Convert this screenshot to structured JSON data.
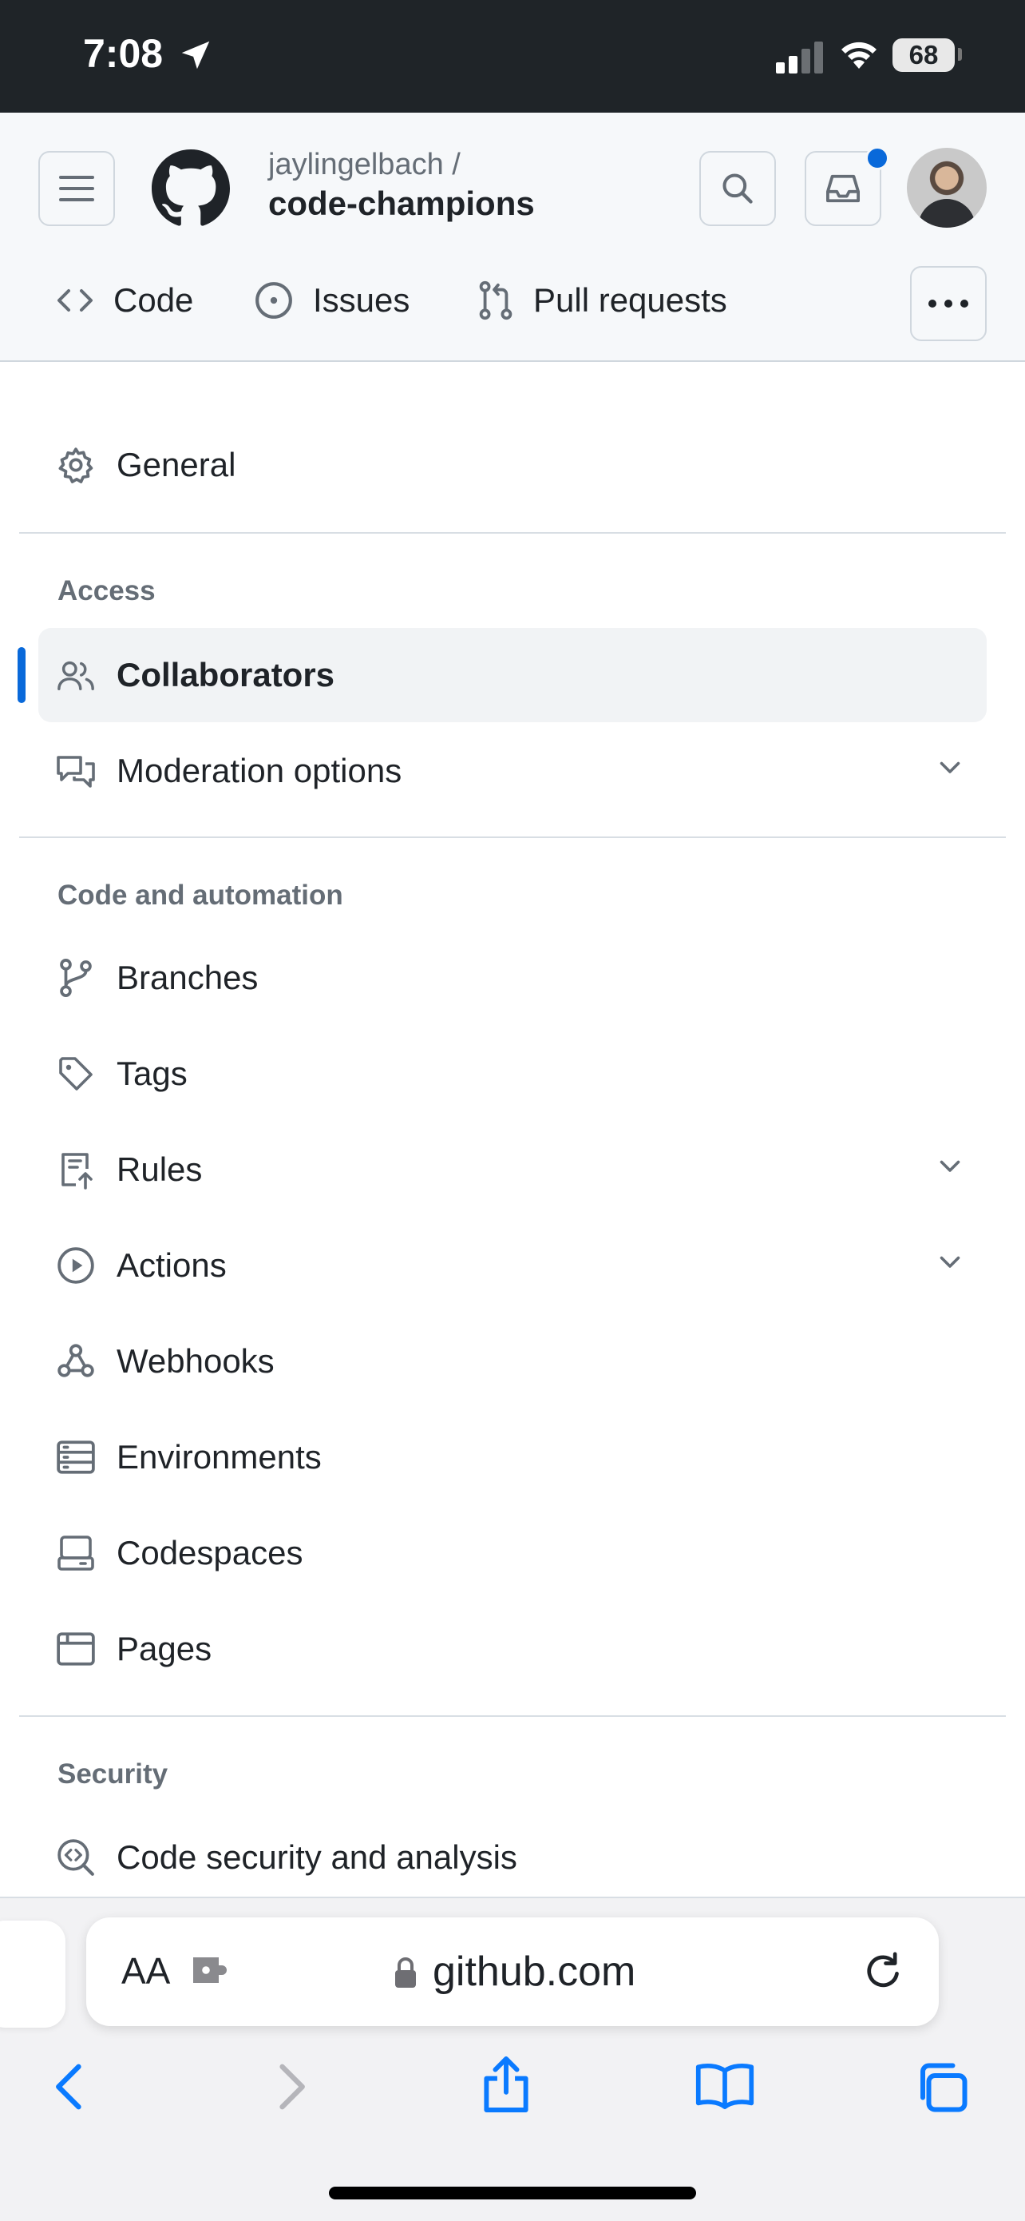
{
  "status_bar": {
    "time": "7:08",
    "battery": "68"
  },
  "header": {
    "owner": "jaylingelbach /",
    "repo": "code-champions",
    "tabs": [
      {
        "label": "Code",
        "icon": "code-icon"
      },
      {
        "label": "Issues",
        "icon": "issue-opened-icon"
      },
      {
        "label": "Pull requests",
        "icon": "git-pull-request-icon"
      }
    ]
  },
  "nav": {
    "general": "General",
    "sections": {
      "access": "Access",
      "code_automation": "Code and automation",
      "security": "Security"
    },
    "items": {
      "collaborators": "Collaborators",
      "moderation": "Moderation options",
      "branches": "Branches",
      "tags": "Tags",
      "rules": "Rules",
      "actions": "Actions",
      "webhooks": "Webhooks",
      "environments": "Environments",
      "codespaces": "Codespaces",
      "pages": "Pages",
      "code_security": "Code security and analysis"
    },
    "active_item": "Collaborators"
  },
  "safari": {
    "text_size_label": "AA",
    "url": "github.com"
  },
  "colors": {
    "accent": "#0969da",
    "status_bar_bg": "#1f2428",
    "header_bg": "#f6f8fa",
    "text_primary": "#1f2328",
    "text_muted": "#656d76",
    "safari_blue": "#0a7aff"
  }
}
